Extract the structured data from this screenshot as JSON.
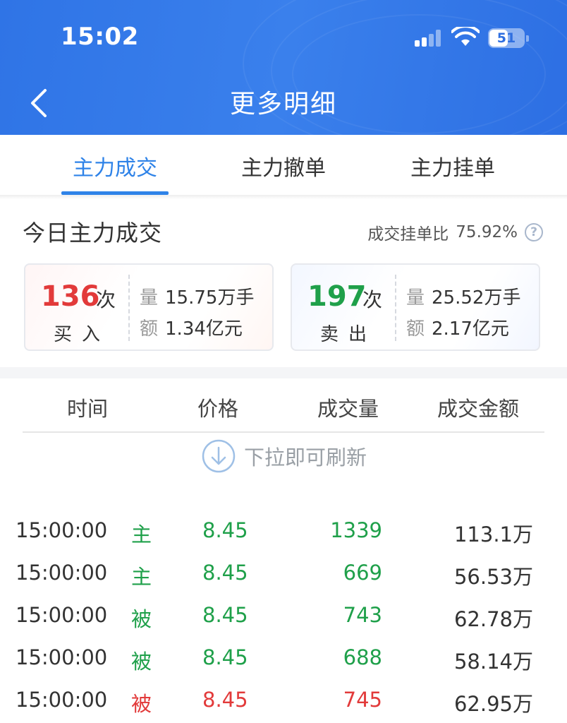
{
  "status_bar": {
    "time": "15:02",
    "battery": "51"
  },
  "header": {
    "title": "更多明细"
  },
  "tabs": [
    {
      "label": "主力成交",
      "active": true
    },
    {
      "label": "主力撤单",
      "active": false
    },
    {
      "label": "主力挂单",
      "active": false
    }
  ],
  "summary": {
    "title": "今日主力成交",
    "ratio_label": "成交挂单比",
    "ratio_value": "75.92%",
    "buy": {
      "count": "136",
      "count_unit": "次",
      "label": "买入",
      "vol_key": "量",
      "vol": "15.75万手",
      "amt_key": "额",
      "amt": "1.34亿元"
    },
    "sell": {
      "count": "197",
      "count_unit": "次",
      "label": "卖出",
      "vol_key": "量",
      "vol": "25.52万手",
      "amt_key": "额",
      "amt": "2.17亿元"
    }
  },
  "table": {
    "headers": {
      "time": "时间",
      "price": "价格",
      "volume": "成交量",
      "amount": "成交金额"
    },
    "refresh_hint": "下拉即可刷新",
    "rows": [
      {
        "time": "15:00:00",
        "flag": "主",
        "price": "8.45",
        "volume": "1339",
        "amount": "113.1万",
        "color": "green"
      },
      {
        "time": "15:00:00",
        "flag": "主",
        "price": "8.45",
        "volume": "669",
        "amount": "56.53万",
        "color": "green"
      },
      {
        "time": "15:00:00",
        "flag": "被",
        "price": "8.45",
        "volume": "743",
        "amount": "62.78万",
        "color": "green"
      },
      {
        "time": "15:00:00",
        "flag": "被",
        "price": "8.45",
        "volume": "688",
        "amount": "58.14万",
        "color": "green"
      },
      {
        "time": "15:00:00",
        "flag": "被",
        "price": "8.45",
        "volume": "745",
        "amount": "62.95万",
        "color": "red"
      }
    ]
  },
  "colors": {
    "accent": "#2f83e8",
    "up": "#e23a3a",
    "down": "#1fa04a"
  }
}
